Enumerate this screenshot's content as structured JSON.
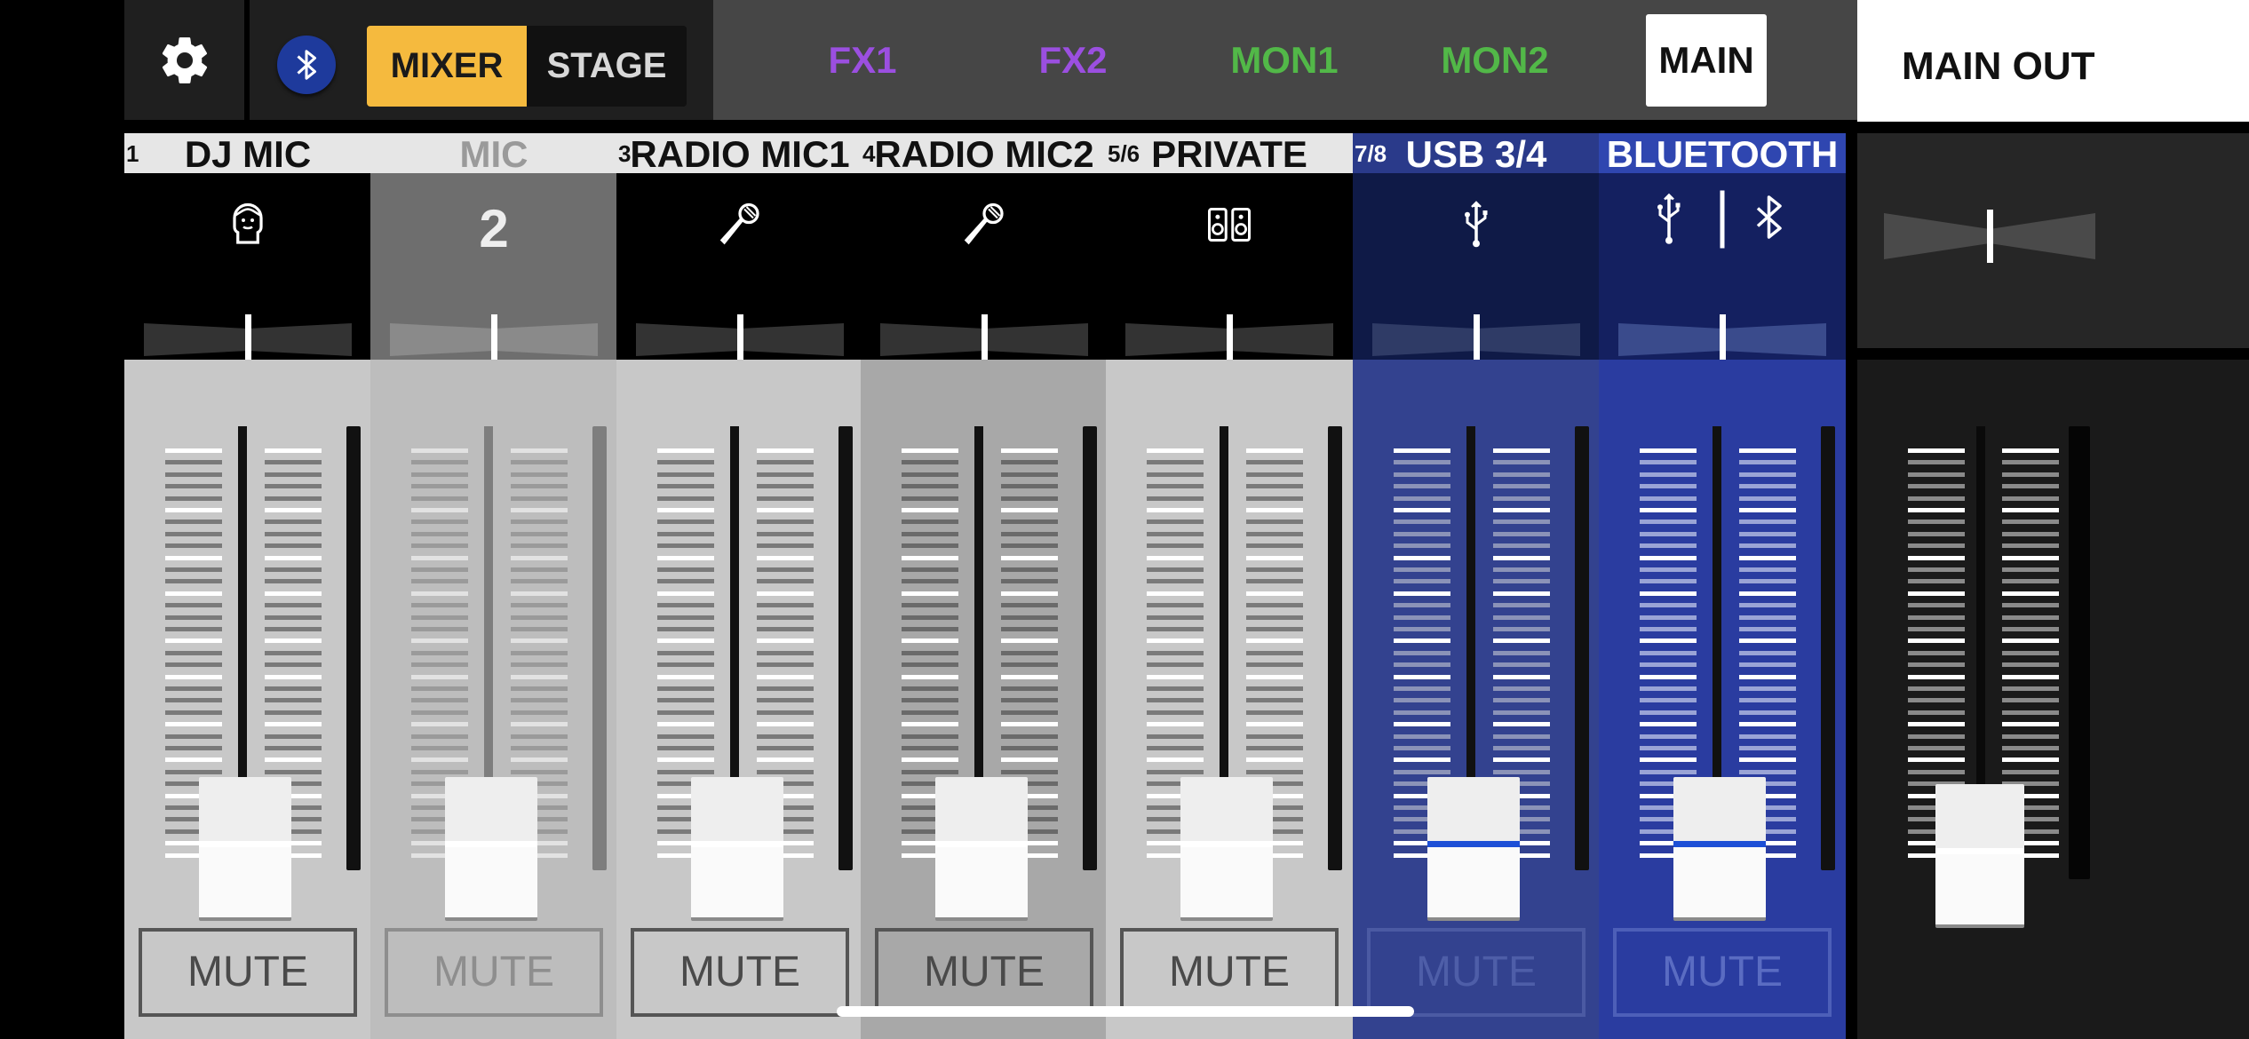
{
  "toolbar": {
    "settings_icon": "gear-icon",
    "bluetooth_icon": "bluetooth-icon",
    "modes": [
      "MIXER",
      "STAGE"
    ],
    "active_mode": "MIXER",
    "buses": [
      {
        "label": "FX1",
        "color": "#9b4fe0"
      },
      {
        "label": "FX2",
        "color": "#9b4fe0"
      },
      {
        "label": "MON1",
        "color": "#52b848"
      },
      {
        "label": "MON2",
        "color": "#52b848"
      },
      {
        "label": "MAIN",
        "color": "#111111"
      }
    ],
    "active_bus": "MAIN",
    "output_title": "MAIN OUT"
  },
  "channels": [
    {
      "num": "1",
      "name": "DJ MIC",
      "icon": "dj-avatar-icon",
      "mute": "MUTE",
      "theme": "light"
    },
    {
      "num": "",
      "name": "MIC",
      "icon_text": "2",
      "icon": "number-2-icon",
      "mute": "MUTE",
      "theme": "disabled"
    },
    {
      "num": "3",
      "name": "RADIO MIC1",
      "icon": "microphone-icon",
      "mute": "MUTE",
      "theme": "light"
    },
    {
      "num": "4",
      "name": "RADIO MIC2",
      "icon": "microphone-icon",
      "mute": "MUTE",
      "theme": "mid"
    },
    {
      "num": "5/6",
      "name": "PRIVATE",
      "icon": "speakers-icon",
      "mute": "MUTE",
      "theme": "light"
    },
    {
      "num": "7/8",
      "name": "USB 3/4",
      "icon": "usb-icon",
      "mute": "MUTE",
      "theme": "blue-dark"
    },
    {
      "num": "",
      "name": "BLUETOOTH",
      "icon": "usb-bluetooth-icon",
      "mute": "MUTE",
      "theme": "blue"
    }
  ],
  "colors": {
    "mixer_accent": "#f5ba3e",
    "fx": "#9b4fe0",
    "mon": "#52b848",
    "blue_channel": "#2a3fa0"
  }
}
